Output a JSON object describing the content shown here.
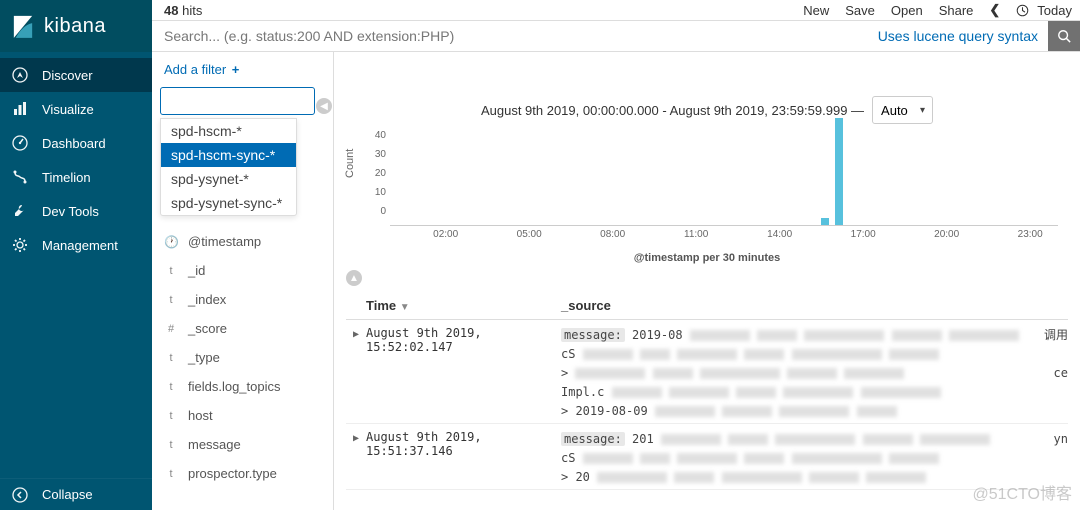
{
  "brand": "kibana",
  "hits_count": "48",
  "hits_label": "hits",
  "toolbar": {
    "new": "New",
    "save": "Save",
    "open": "Open",
    "share": "Share",
    "today": "Today"
  },
  "search": {
    "placeholder": "Search... (e.g. status:200 AND extension:PHP)",
    "hint": "Uses lucene query syntax"
  },
  "nav": [
    {
      "icon": "compass",
      "label": "Discover"
    },
    {
      "icon": "bar",
      "label": "Visualize"
    },
    {
      "icon": "dash",
      "label": "Dashboard"
    },
    {
      "icon": "timelion",
      "label": "Timelion"
    },
    {
      "icon": "wrench",
      "label": "Dev Tools"
    },
    {
      "icon": "gear",
      "label": "Management"
    }
  ],
  "collapse_label": "Collapse",
  "add_filter": "Add a filter",
  "index_dropdown": [
    "spd-hscm-*",
    "spd-hscm-sync-*",
    "spd-ysynet-*",
    "spd-ysynet-sync-*"
  ],
  "index_selected": "spd-hscm-sync-*",
  "fields": [
    {
      "t": "clock",
      "name": "@timestamp"
    },
    {
      "t": "t",
      "name": "_id"
    },
    {
      "t": "t",
      "name": "_index"
    },
    {
      "t": "#",
      "name": "_score"
    },
    {
      "t": "t",
      "name": "_type"
    },
    {
      "t": "t",
      "name": "fields.log_topics"
    },
    {
      "t": "t",
      "name": "host"
    },
    {
      "t": "t",
      "name": "message"
    },
    {
      "t": "t",
      "name": "prospector.type"
    }
  ],
  "timerange": "August 9th 2019, 00:00:00.000 - August 9th 2019, 23:59:59.999 —",
  "interval": "Auto",
  "chart_data": {
    "type": "bar",
    "xlabel": "@timestamp per 30 minutes",
    "ylabel": "Count",
    "yticks": [
      40,
      30,
      20,
      10,
      0
    ],
    "xticks": [
      "02:00",
      "05:00",
      "08:00",
      "11:00",
      "14:00",
      "17:00",
      "20:00",
      "23:00"
    ],
    "bars": [
      {
        "x": "15:30",
        "value": 3
      },
      {
        "x": "16:00",
        "value": 45
      }
    ],
    "xrange_hours": [
      0,
      24
    ]
  },
  "table": {
    "headers": {
      "time": "Time",
      "source": "_source"
    },
    "rows": [
      {
        "time": "August 9th 2019, 15:52:02.147",
        "msg_label": "message:",
        "msg_start": "2019-08",
        "trail": "调用",
        "line2_pre": "cS",
        "line3_pre": ">",
        "line3_suf": "ce",
        "line4": "Impl.c",
        "line5": "> 2019-08-09"
      },
      {
        "time": "August 9th 2019, 15:51:37.146",
        "msg_label": "message:",
        "msg_start": "201",
        "trail": "yn",
        "line2_pre": "cS",
        "line3_pre": "> 20"
      }
    ]
  },
  "watermark": "@51CTO博客"
}
